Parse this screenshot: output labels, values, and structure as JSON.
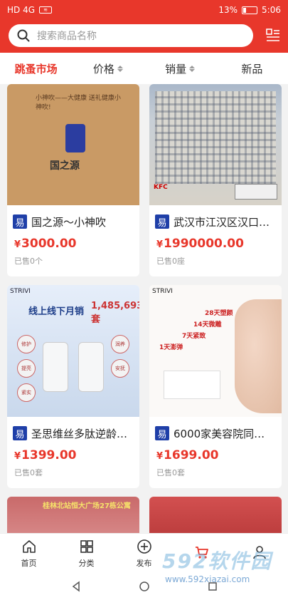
{
  "status_bar": {
    "left_indicators": "HD 4G",
    "battery": "13%",
    "time": "5:06"
  },
  "search": {
    "placeholder": "搜索商品名称"
  },
  "tabs": [
    {
      "label": "跳蚤市场"
    },
    {
      "label": "价格"
    },
    {
      "label": "销量"
    },
    {
      "label": "新品"
    }
  ],
  "products": [
    {
      "badge": "易",
      "title": "国之源～小神吹",
      "price": "3000.00",
      "sold": "已售0个"
    },
    {
      "badge": "易",
      "title": "武汉市江汉区汉口…",
      "price": "1990000.00",
      "sold": "已售0座"
    },
    {
      "badge": "易",
      "title": "圣思维丝多肽逆龄…",
      "price": "1399.00",
      "sold": "已售0套"
    },
    {
      "badge": "易",
      "title": "6000家美容院同…",
      "price": "1699.00",
      "sold": "已售0套"
    }
  ],
  "images": {
    "box": {
      "text": "国之源",
      "lines": "小神吹——大健康 送礼健康小神吹!"
    },
    "building": {
      "sign": "KFC"
    },
    "serum": {
      "brand": "STRIVI",
      "head": "线上线下月销",
      "num": "1,485,693套",
      "dots": [
        "修护",
        "润养",
        "提亮",
        "紧实",
        "安抚"
      ]
    },
    "face": {
      "brand": "STRIVI",
      "line1": "28天塑颜",
      "line2": "14天微雕",
      "line3": "7天紧致",
      "line4": "1天澎弹"
    },
    "room": {
      "text": "桂林北站恒大广场27栋公寓"
    }
  },
  "currency": "¥",
  "bottom_nav": [
    {
      "label": "首页",
      "icon": "home-icon"
    },
    {
      "label": "分类",
      "icon": "grid-icon"
    },
    {
      "label": "发布",
      "icon": "plus-circle-icon"
    },
    {
      "label": "",
      "icon": "cart-icon"
    },
    {
      "label": "",
      "icon": "user-icon"
    }
  ],
  "watermark": {
    "big": "592软件园",
    "url": "www.592xiazai.com"
  },
  "colors": {
    "accent": "#e8372b",
    "badge": "#1f3fa8"
  }
}
